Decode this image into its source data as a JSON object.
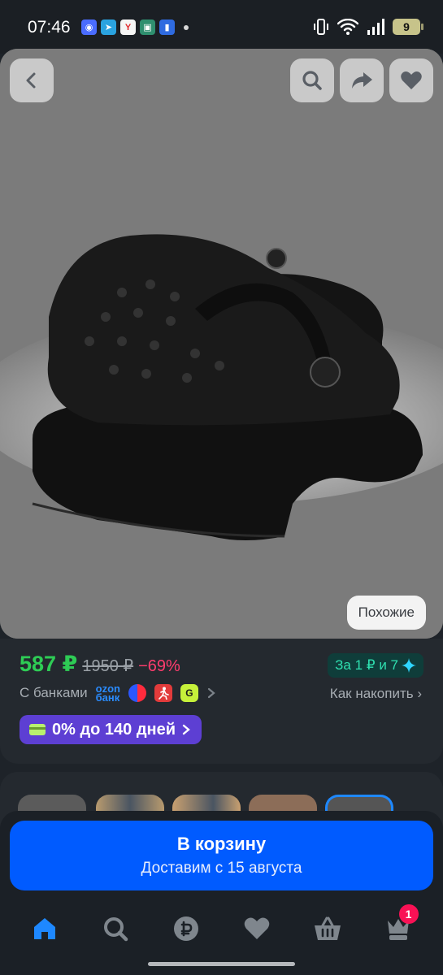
{
  "status_bar": {
    "time": "07:46",
    "notification_icons": [
      "messenger-icon",
      "telegram-icon",
      "yandex-icon",
      "terminal-icon",
      "bank-app-icon"
    ],
    "battery_level": "9"
  },
  "gallery": {
    "similar_label": "Похожие"
  },
  "price": {
    "current": "587 ₽",
    "old": "1950 ₽",
    "discount": "−69%",
    "points_badge": "За 1 ₽ и 7"
  },
  "banks": {
    "label": "С банками",
    "ozon_logo_line1": "ozon",
    "ozon_logo_line2": "банк",
    "accumulate_label": "Как накопить"
  },
  "installment": {
    "label": "0% до 140 дней"
  },
  "cart": {
    "button_title": "В корзину",
    "delivery": "Доставим с 15 августа"
  },
  "nav": {
    "cart_badge": "1"
  },
  "colors": {
    "accent_blue": "#005bff",
    "price_green": "#2ecc55",
    "discount_red": "#ff3d6e",
    "installment_purple": "#5d3fd3"
  }
}
